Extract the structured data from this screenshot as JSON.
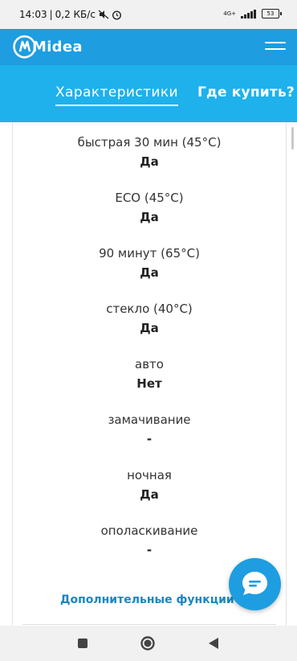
{
  "status_bar": {
    "time": "14:03",
    "speed": "0,2 КБ/с",
    "network": "4G+",
    "battery": "53"
  },
  "header": {
    "brand": "Midea",
    "menu_icon": "hamburger-icon"
  },
  "tabs": {
    "specs": "Характеристики",
    "where_to_buy": "Где купить?"
  },
  "specs": [
    {
      "label": "быстрая 30 мин (45°C)",
      "value": "Да"
    },
    {
      "label": "ECO (45°C)",
      "value": "Да"
    },
    {
      "label": "90 минут (65°C)",
      "value": "Да"
    },
    {
      "label": "стекло (40°C)",
      "value": "Да"
    },
    {
      "label": "авто",
      "value": "Нет"
    },
    {
      "label": "замачивание",
      "value": "-"
    },
    {
      "label": "ночная",
      "value": "Да"
    },
    {
      "label": "ополаскивание",
      "value": "-"
    }
  ],
  "more_functions": "Дополнительные функции",
  "chat_button": "chat-icon",
  "nav": {
    "recent": "square-icon",
    "home": "circle-icon",
    "back": "triangle-back-icon"
  },
  "colors": {
    "header": "#1e9de0",
    "tabs": "#1eb1ec",
    "link": "#1a86c2"
  }
}
